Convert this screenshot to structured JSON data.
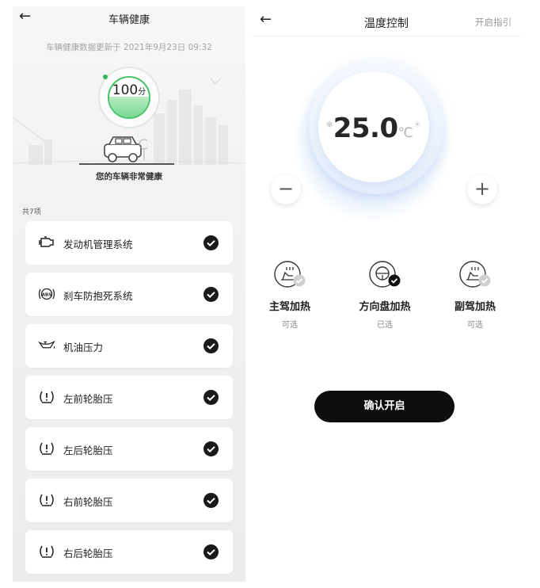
{
  "left": {
    "title": "车辆健康",
    "update_text": "车辆健康数据更新于 2021年9月23日 09:32",
    "score": "100",
    "score_unit": "分",
    "score_fraction": 1.0,
    "status": "您的车辆非常健康",
    "count": "共7项",
    "items": [
      {
        "label": "发动机管理系统",
        "icon": "engine-icon",
        "status": "ok"
      },
      {
        "label": "刹车防抱死系统",
        "icon": "abs-icon",
        "status": "ok"
      },
      {
        "label": "机油压力",
        "icon": "oil-pressure-icon",
        "status": "ok"
      },
      {
        "label": "左前轮胎压",
        "icon": "tire-pressure-icon",
        "status": "ok"
      },
      {
        "label": "左后轮胎压",
        "icon": "tire-pressure-icon",
        "status": "ok"
      },
      {
        "label": "右前轮胎压",
        "icon": "tire-pressure-icon",
        "status": "ok"
      },
      {
        "label": "右后轮胎压",
        "icon": "tire-pressure-icon",
        "status": "ok"
      }
    ]
  },
  "right": {
    "title": "温度控制",
    "guide": "开启指引",
    "temperature": "25.0",
    "unit": "℃",
    "minus": "−",
    "plus": "+",
    "heats": [
      {
        "name": "主驾加热",
        "status": "可选",
        "icon": "driver-seat-heat-icon",
        "selected": false
      },
      {
        "name": "方向盘加热",
        "status": "已选",
        "icon": "steering-wheel-heat-icon",
        "selected": true
      },
      {
        "name": "副驾加热",
        "status": "可选",
        "icon": "passenger-seat-heat-icon",
        "selected": false
      }
    ],
    "confirm": "确认开启"
  },
  "colors": {
    "accent_green": "#47c46b",
    "button_dark": "#0e0e0e",
    "halo_blue": "#96bef5"
  }
}
